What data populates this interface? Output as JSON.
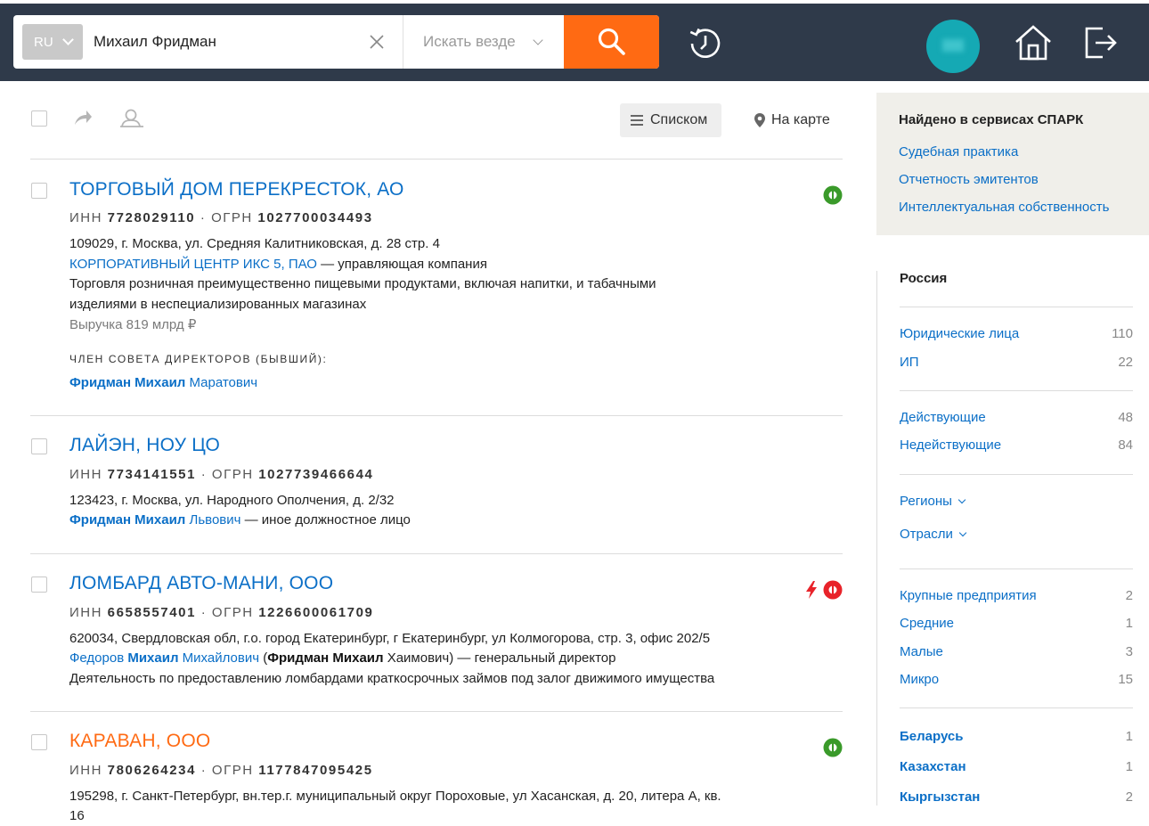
{
  "header": {
    "lang": "RU",
    "search_value": "Михаил Фридман",
    "scope": "Искать везде"
  },
  "toolbar": {
    "view_list": "Списком",
    "view_map": "На карте"
  },
  "results": [
    {
      "title": "ТОРГОВЫЙ ДОМ ПЕРЕКРЕСТОК, АО",
      "inn_label": "ИНН",
      "inn": "7728029110",
      "ogrn_label": "ОГРН",
      "ogrn": "1027700034493",
      "address": "109029, г. Москва, ул. Средняя Калитниковская, д. 28 стр. 4",
      "mgmt_link": "КОРПОРАТИВНЫЙ ЦЕНТР ИКС 5, ПАО",
      "mgmt_suffix": " — управляющая компания",
      "activity_1": "Торговля розничная преимущественно пищевыми продуктами, включая напитки, и табачными",
      "activity_2": "изделиями в неспециализированных магазинах",
      "revenue": "Выручка 819 млрд ₽",
      "role": "ЧЛЕН СОВЕТА ДИРЕКТОРОВ (БЫВШИЙ):",
      "person_bold": "Фридман Михаил",
      "person_rest": " Маратович",
      "status": "active"
    },
    {
      "title": "ЛАЙЭН, НОУ ЦО",
      "inn_label": "ИНН",
      "inn": "7734141551",
      "ogrn_label": "ОГРН",
      "ogrn": "1027739466644",
      "address": "123423, г. Москва, ул. Народного Ополчения, д. 2/32",
      "person_bold": "Фридман Михаил",
      "person_rest": " Львович",
      "person_suffix": " — иное должностное лицо"
    },
    {
      "title": "ЛОМБАРД АВТО-МАНИ, ООО",
      "inn_label": "ИНН",
      "inn": "6658557401",
      "ogrn_label": "ОГРН",
      "ogrn": "1226600061709",
      "address": "620034, Свердловская обл, г.о. город Екатеринбург, г Екатеринбург, ул Колмогорова, стр. 3, офис 202/5",
      "person_first": "Федоров ",
      "person_bold": "Михаил",
      "person_rest": " Михайлович",
      "paren_open": " (",
      "alias_bold": "Фридман Михаил",
      "alias_rest": " Хаимович)",
      "person_suffix": " — генеральный директор",
      "activity_1": "Деятельность по предоставлению ломбардами краткосрочных займов под залог движимого имущества",
      "status": "inactive"
    },
    {
      "title": "КАРАВАН, ООО",
      "inn_label": "ИНН",
      "inn": "7806264234",
      "ogrn_label": "ОГРН",
      "ogrn": "1177847095425",
      "address": "195298, г. Санкт-Петербург, вн.тер.г. муниципальный округ Пороховые, ул Хасанская, д. 20, литера А, кв.",
      "address_2": "16",
      "status": "active"
    }
  ],
  "spark": {
    "title": "Найдено в сервисах СПАРК",
    "links": [
      "Судебная практика",
      "Отчетность эмитентов",
      "Интеллектуальная собственность"
    ]
  },
  "filters": {
    "heading": "Россия",
    "group1": [
      {
        "label": "Юридические лица",
        "count": "110"
      },
      {
        "label": "ИП",
        "count": "22"
      }
    ],
    "group2": [
      {
        "label": "Действующие",
        "count": "48"
      },
      {
        "label": "Недействующие",
        "count": "84"
      }
    ],
    "regions": "Регионы",
    "industries": "Отрасли",
    "group3": [
      {
        "label": "Крупные предприятия",
        "count": "2"
      },
      {
        "label": "Средние",
        "count": "1"
      },
      {
        "label": "Малые",
        "count": "3"
      },
      {
        "label": "Микро",
        "count": "15"
      }
    ],
    "group4": [
      {
        "label": "Беларусь",
        "count": "1"
      },
      {
        "label": "Казахстан",
        "count": "1"
      },
      {
        "label": "Кыргызстан",
        "count": "2"
      }
    ]
  },
  "colors": {
    "header_bg": "#2f3a4a",
    "accent_orange": "#ff6a13",
    "link_blue": "#0b6fc7",
    "status_green": "#3a9a2a",
    "status_red": "#e8232a",
    "avatar": "#15a9b4"
  }
}
